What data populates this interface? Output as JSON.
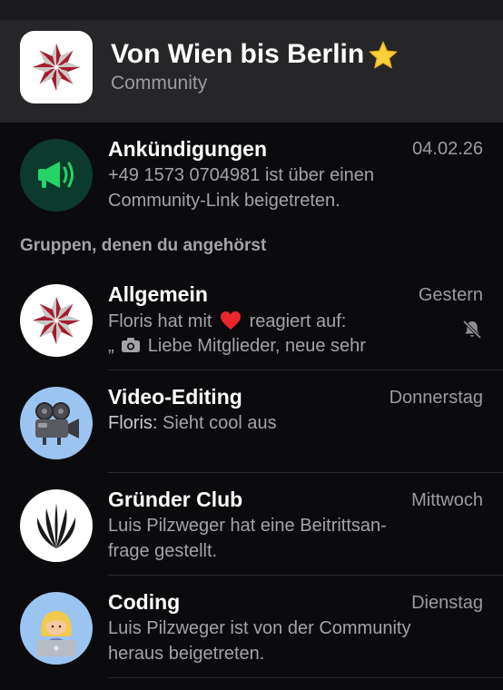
{
  "community": {
    "title": "Von Wien bis Berlin",
    "title_emoji": "star",
    "subtitle": "Community"
  },
  "announcements": {
    "name": "Ankündigungen",
    "time": "04.02.26",
    "line1": "+49 1573 0704981 ist über einen",
    "line2": "Community-Link beigetreten.",
    "icon": "megaphone-icon",
    "avatar_color": "#0c3b2e"
  },
  "section_label": "Gruppen, denen du angehörst",
  "groups": [
    {
      "name": "Allgemein",
      "time": "Gestern",
      "line1_prefix": "Floris hat mit",
      "line1_suffix": "reagiert auf:",
      "line2": "„",
      "line2_rest": "Liebe Mitglieder, neue sehr",
      "muted": true
    },
    {
      "name": "Video-Editing",
      "time": "Donnerstag",
      "sender": "Floris:",
      "line1": "Sieht cool aus"
    },
    {
      "name": "Gründer Club",
      "time": "Mittwoch",
      "line1": "Luis Pilzweger hat eine Beitrittsan-",
      "line2": "frage gestellt."
    },
    {
      "name": "Coding",
      "time": "Dienstag",
      "line1": "Luis Pilzweger ist von der Community",
      "line2": "heraus beigetreten."
    }
  ],
  "colors": {
    "background": "#0b0a0d",
    "header": "#262628",
    "accent_green": "#25d366",
    "logo_red": "#a51d2d",
    "avatar_blue": "#9cc4f0"
  }
}
